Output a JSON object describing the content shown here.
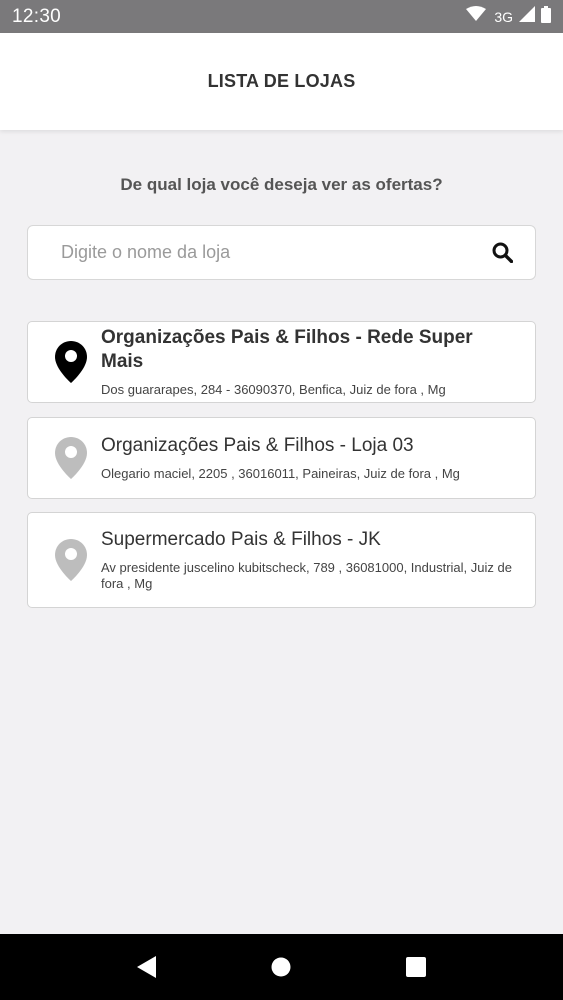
{
  "status_bar": {
    "time": "12:30",
    "network": "3G"
  },
  "header": {
    "title": "LISTA DE LOJAS"
  },
  "prompt": "De qual loja você deseja ver as ofertas?",
  "search": {
    "placeholder": "Digite o nome da loja",
    "value": ""
  },
  "stores": [
    {
      "name": "Organizações Pais & Filhos - Rede Super Mais",
      "address": "Dos guararapes, 284 - 36090370, Benfica, Juiz de fora , Mg",
      "selected": true,
      "pin_color": "#000000"
    },
    {
      "name": "Organizações Pais & Filhos - Loja 03",
      "address": "Olegario maciel, 2205 , 36016011, Paineiras, Juiz de fora , Mg",
      "selected": false,
      "pin_color": "#bdbdbd"
    },
    {
      "name": "Supermercado Pais & Filhos - JK",
      "address": "Av presidente juscelino kubitscheck, 789 , 36081000, Industrial, Juiz de fora , Mg",
      "selected": false,
      "pin_color": "#bdbdbd"
    }
  ],
  "icons": {
    "wifi": "wifi-icon",
    "signal": "signal-icon",
    "battery": "battery-icon",
    "search": "search-icon",
    "pin": "location-pin-icon",
    "back": "back-icon",
    "home": "home-icon",
    "recents": "recents-icon"
  }
}
